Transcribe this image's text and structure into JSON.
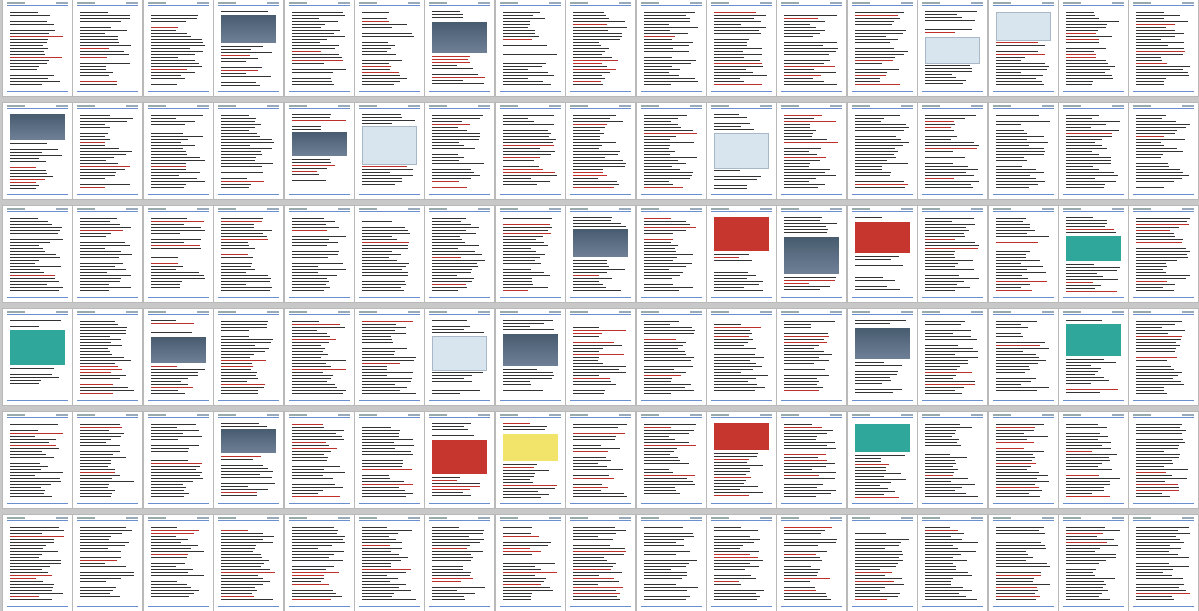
{
  "window": {
    "title": "",
    "view": "page-thumbnail-grid"
  },
  "colors": {
    "background": "#c8c8c8",
    "page": "#ffffff",
    "text": "#333333",
    "highlight": "#c0302b",
    "rule": "#6a8fd0"
  },
  "grid": {
    "columns": 17,
    "rows": 6,
    "image_pages": [
      {
        "row": 0,
        "col": 3,
        "kind": "photo"
      },
      {
        "row": 0,
        "col": 6,
        "kind": "photo"
      },
      {
        "row": 0,
        "col": 13,
        "kind": "light"
      },
      {
        "row": 0,
        "col": 14,
        "kind": "light"
      },
      {
        "row": 1,
        "col": 0,
        "kind": "photo"
      },
      {
        "row": 1,
        "col": 4,
        "kind": "photo"
      },
      {
        "row": 1,
        "col": 5,
        "kind": "light"
      },
      {
        "row": 1,
        "col": 10,
        "kind": "light"
      },
      {
        "row": 2,
        "col": 8,
        "kind": "photo"
      },
      {
        "row": 2,
        "col": 10,
        "kind": "red"
      },
      {
        "row": 2,
        "col": 11,
        "kind": "photo"
      },
      {
        "row": 2,
        "col": 12,
        "kind": "red"
      },
      {
        "row": 2,
        "col": 15,
        "kind": "teal"
      },
      {
        "row": 3,
        "col": 0,
        "kind": "teal"
      },
      {
        "row": 3,
        "col": 2,
        "kind": "photo"
      },
      {
        "row": 3,
        "col": 6,
        "kind": "light"
      },
      {
        "row": 3,
        "col": 7,
        "kind": "photo"
      },
      {
        "row": 3,
        "col": 12,
        "kind": "photo"
      },
      {
        "row": 3,
        "col": 15,
        "kind": "teal"
      },
      {
        "row": 4,
        "col": 3,
        "kind": "photo"
      },
      {
        "row": 4,
        "col": 6,
        "kind": "red"
      },
      {
        "row": 4,
        "col": 7,
        "kind": "yellow"
      },
      {
        "row": 4,
        "col": 10,
        "kind": "red"
      },
      {
        "row": 4,
        "col": 12,
        "kind": "teal"
      }
    ]
  }
}
